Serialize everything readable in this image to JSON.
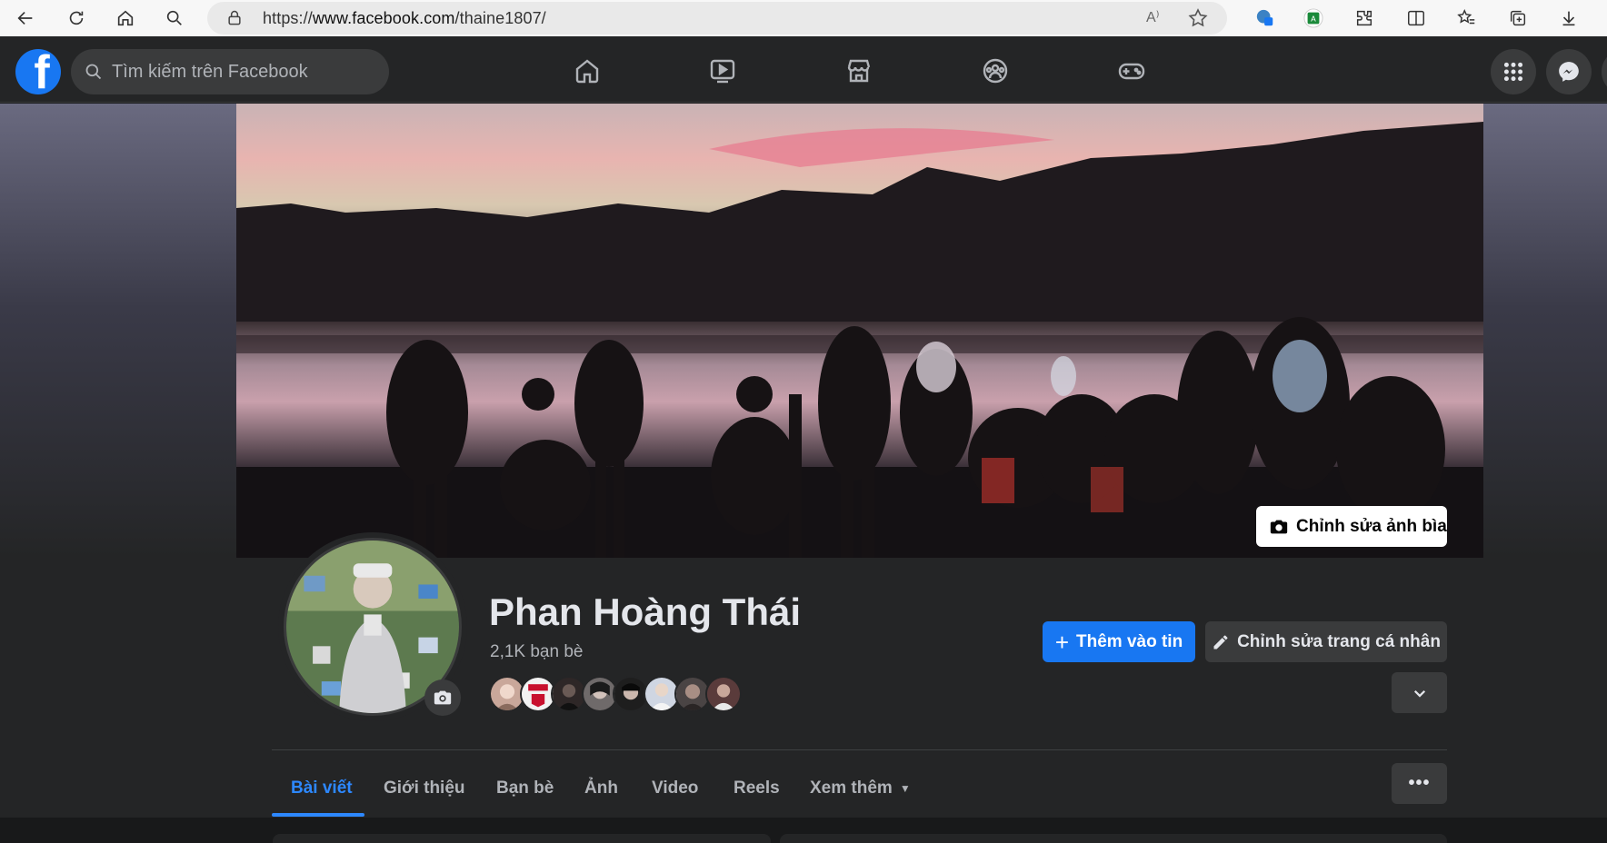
{
  "browser": {
    "url_prefix": "https://",
    "url_host": "www.facebook.com",
    "url_path": "/thaine1807/",
    "read_aloud": "A⁾"
  },
  "header": {
    "logo_text": "f",
    "search_placeholder": "Tìm kiếm trên Facebook"
  },
  "cover": {
    "edit_label": "Chỉnh sửa ảnh bìa"
  },
  "profile": {
    "name": "Phan Hoàng Thái",
    "friends_count": "2,1K bạn bè",
    "add_story_label": "Thêm vào tin",
    "edit_profile_label": "Chỉnh sửa trang cá nhân",
    "friend_avatar_colors": [
      "#c9a79a",
      "#d9d9d9",
      "#3b3030",
      "#6f6a6a",
      "#222222",
      "#cfd6e2",
      "#4a4444",
      "#5a3b3b"
    ]
  },
  "tabs": [
    {
      "label": "Bài viết"
    },
    {
      "label": "Giới thiệu"
    },
    {
      "label": "Bạn bè"
    },
    {
      "label": "Ảnh"
    },
    {
      "label": "Video"
    },
    {
      "label": "Reels"
    },
    {
      "label": "Xem thêm"
    }
  ],
  "more_button": "•••",
  "colors": {
    "accent": "#1877f2",
    "active_tab": "#2d88ff",
    "surface": "#242526",
    "button_secondary": "#3a3b3c"
  }
}
